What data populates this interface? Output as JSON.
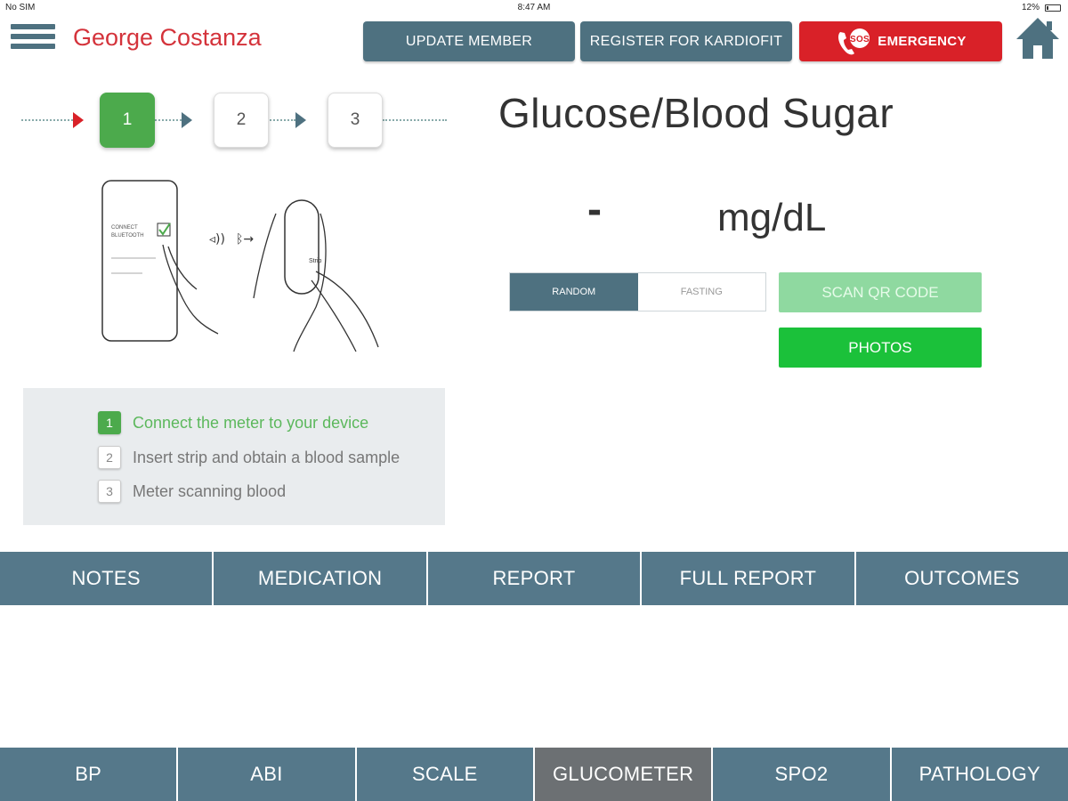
{
  "status_bar": {
    "carrier": "No SIM",
    "time": "8:47 AM",
    "battery": "12%"
  },
  "header": {
    "member_name": "George Costanza",
    "update_member": "UPDATE MEMBER",
    "register": "REGISTER FOR KARDIOFIT",
    "emergency": "EMERGENCY",
    "sos_badge": "SOS"
  },
  "stepper": {
    "steps": [
      "1",
      "2",
      "3"
    ],
    "active": 1
  },
  "illustration": {
    "phone_label_1": "CONNECT",
    "phone_label_2": "BLUETOOTH",
    "meter_label": "Strip"
  },
  "instructions": [
    {
      "num": "1",
      "text": "Connect the meter to your device",
      "active": true
    },
    {
      "num": "2",
      "text": "Insert strip and obtain a blood sample",
      "active": false
    },
    {
      "num": "3",
      "text": "Meter scanning blood",
      "active": false
    }
  ],
  "reading": {
    "title": "Glucose/Blood Sugar",
    "value": "-",
    "unit": "mg/dL"
  },
  "mode_toggle": {
    "random": "RANDOM",
    "fasting": "FASTING",
    "selected": "RANDOM"
  },
  "actions": {
    "scan_qr": "SCAN QR CODE",
    "photos": "PHOTOS"
  },
  "top_tabs": [
    "NOTES",
    "MEDICATION",
    "REPORT",
    "FULL REPORT",
    "OUTCOMES"
  ],
  "bottom_tabs": [
    "BP",
    "ABI",
    "SCALE",
    "GLUCOMETER",
    "SPO2",
    "PATHOLOGY"
  ],
  "bottom_tabs_selected": "GLUCOMETER",
  "colors": {
    "teal": "#4e7180",
    "red": "#d92128",
    "green": "#4caa4c",
    "bright_green": "#1bc13a",
    "light_green": "#8fd9a0"
  }
}
